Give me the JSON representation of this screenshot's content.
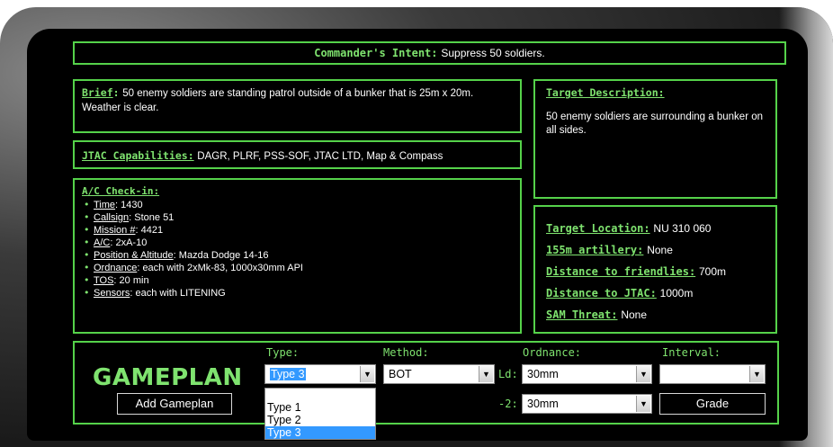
{
  "intent": {
    "label": "Commander's Intent:",
    "text": "Suppress 50 soldiers."
  },
  "brief": {
    "label": "Brief",
    "text": "50 enemy soldiers are standing patrol outside of a bunker that is 25m x 20m. Weather is clear."
  },
  "jtac": {
    "label": "JTAC Capabilities:",
    "text": "DAGR, PLRF, PSS-SOF, JTAC LTD, Map & Compass"
  },
  "checkin": {
    "title": "A/C Check-in:",
    "items": [
      {
        "label": "Time",
        "value": "1430"
      },
      {
        "label": "Callsign",
        "value": "Stone 51"
      },
      {
        "label": "Mission #",
        "value": "4421"
      },
      {
        "label": "A/C",
        "value": "2xA-10"
      },
      {
        "label": "Position & Altitude",
        "value": "Mazda Dodge 14-16"
      },
      {
        "label": "Ordnance",
        "value": "each with 2xMk-83, 1000x30mm API"
      },
      {
        "label": "TOS",
        "value": "20 min"
      },
      {
        "label": "Sensors",
        "value": "each with LITENING"
      }
    ]
  },
  "target_description": {
    "label": "Target Description:",
    "text": "50 enemy soldiers are surrounding a bunker on all sides."
  },
  "target_info": {
    "location_label": "Target Location:",
    "location_value": "NU 310 060",
    "artillery_label": "155m artillery:",
    "artillery_value": "None",
    "friendlies_label": "Distance to friendlies:",
    "friendlies_value": "700m",
    "jtac_label": "Distance to JTAC:",
    "jtac_value": "1000m",
    "sam_label": "SAM Threat:",
    "sam_value": "None"
  },
  "gameplan": {
    "title": "GAMEPLAN",
    "add_button": "Add Gameplan",
    "grade_button": "Grade",
    "type_label": "Type:",
    "method_label": "Method:",
    "ordnance_label": "Ordnance:",
    "interval_label": "Interval:",
    "ld_label": "Ld:",
    "minus2_label": "-2:",
    "type_value": "Type 3",
    "method_value": "BOT",
    "ordnance_ld_value": "30mm",
    "ordnance_2_value": "30mm",
    "interval_value": "",
    "type_options": [
      "Type 1",
      "Type 2",
      "Type 3"
    ]
  },
  "colors": {
    "accent": "#55d24a",
    "text_green": "#7fe36f",
    "highlight": "#3399ff"
  }
}
